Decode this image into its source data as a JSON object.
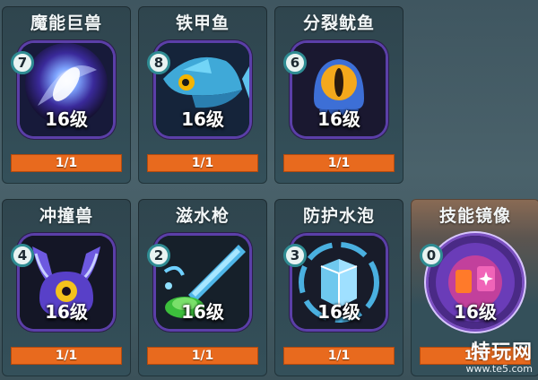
{
  "cards": [
    {
      "name": "魔能巨兽",
      "count": "7",
      "level": "16级",
      "progress": "1/1",
      "progress_fraction": 1,
      "icon": "magic-beast-icon"
    },
    {
      "name": "铁甲鱼",
      "count": "8",
      "level": "16级",
      "progress": "1/1",
      "progress_fraction": 1,
      "icon": "armor-fish-icon"
    },
    {
      "name": "分裂鱿鱼",
      "count": "6",
      "level": "16级",
      "progress": "1/1",
      "progress_fraction": 1,
      "icon": "split-squid-icon"
    },
    {
      "name": "冲撞兽",
      "count": "4",
      "level": "16级",
      "progress": "1/1",
      "progress_fraction": 1,
      "icon": "charge-beast-icon"
    },
    {
      "name": "滋水枪",
      "count": "2",
      "level": "16级",
      "progress": "1/1",
      "progress_fraction": 1,
      "icon": "water-gun-icon"
    },
    {
      "name": "防护水泡",
      "count": "3",
      "level": "16级",
      "progress": "1/1",
      "progress_fraction": 1,
      "icon": "bubble-shield-icon"
    },
    {
      "name": "技能镜像",
      "count": "0",
      "level": "16级",
      "progress": "1/1",
      "progress_fraction": 1,
      "icon": "skill-mirror-icon"
    }
  ],
  "watermark": {
    "brand": "特玩网",
    "url": "www.te5.com"
  },
  "colors": {
    "progress_bar": "#e86a1e",
    "icon_frame": "#5b3fa8",
    "badge_ring": "#2f8c93",
    "card_bg": "#34505a",
    "special_card_top": "#8a6b54"
  }
}
